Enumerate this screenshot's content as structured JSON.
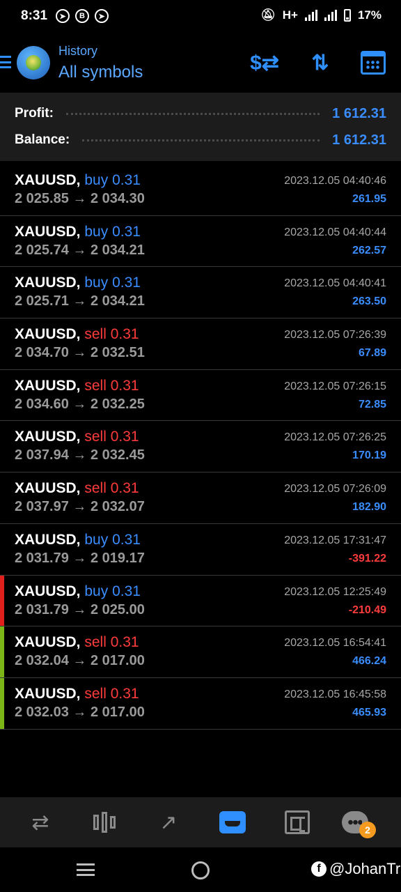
{
  "status_bar": {
    "time": "8:31",
    "network": "H+",
    "battery": "17%",
    "icons": [
      "telegram-icon",
      "b-icon",
      "telegram-icon",
      "mute-icon",
      "signal-icon",
      "signal-icon",
      "battery-icon"
    ]
  },
  "header": {
    "subtitle": "History",
    "title": "All symbols",
    "actions": [
      "dollar-swap-icon",
      "sort-icon",
      "calendar-icon"
    ]
  },
  "summary": {
    "profit_label": "Profit:",
    "profit_value": "1 612.31",
    "balance_label": "Balance:",
    "balance_value": "1 612.31"
  },
  "deals": [
    {
      "symbol": "XAUUSD,",
      "side": "buy",
      "volume": "0.31",
      "open": "2 025.85",
      "close": "2 034.30",
      "time": "2023.12.05 04:40:46",
      "profit": "261.95",
      "accent": ""
    },
    {
      "symbol": "XAUUSD,",
      "side": "buy",
      "volume": "0.31",
      "open": "2 025.74",
      "close": "2 034.21",
      "time": "2023.12.05 04:40:44",
      "profit": "262.57",
      "accent": ""
    },
    {
      "symbol": "XAUUSD,",
      "side": "buy",
      "volume": "0.31",
      "open": "2 025.71",
      "close": "2 034.21",
      "time": "2023.12.05 04:40:41",
      "profit": "263.50",
      "accent": ""
    },
    {
      "symbol": "XAUUSD,",
      "side": "sell",
      "volume": "0.31",
      "open": "2 034.70",
      "close": "2 032.51",
      "time": "2023.12.05 07:26:39",
      "profit": "67.89",
      "accent": ""
    },
    {
      "symbol": "XAUUSD,",
      "side": "sell",
      "volume": "0.31",
      "open": "2 034.60",
      "close": "2 032.25",
      "time": "2023.12.05 07:26:15",
      "profit": "72.85",
      "accent": ""
    },
    {
      "symbol": "XAUUSD,",
      "side": "sell",
      "volume": "0.31",
      "open": "2 037.94",
      "close": "2 032.45",
      "time": "2023.12.05 07:26:25",
      "profit": "170.19",
      "accent": ""
    },
    {
      "symbol": "XAUUSD,",
      "side": "sell",
      "volume": "0.31",
      "open": "2 037.97",
      "close": "2 032.07",
      "time": "2023.12.05 07:26:09",
      "profit": "182.90",
      "accent": ""
    },
    {
      "symbol": "XAUUSD,",
      "side": "buy",
      "volume": "0.31",
      "open": "2 031.79",
      "close": "2 019.17",
      "time": "2023.12.05 17:31:47",
      "profit": "-391.22",
      "accent": ""
    },
    {
      "symbol": "XAUUSD,",
      "side": "buy",
      "volume": "0.31",
      "open": "2 031.79",
      "close": "2 025.00",
      "time": "2023.12.05 12:25:49",
      "profit": "-210.49",
      "accent": "#e0201c"
    },
    {
      "symbol": "XAUUSD,",
      "side": "sell",
      "volume": "0.31",
      "open": "2 032.04",
      "close": "2 017.00",
      "time": "2023.12.05 16:54:41",
      "profit": "466.24",
      "accent": "#7cb518"
    },
    {
      "symbol": "XAUUSD,",
      "side": "sell",
      "volume": "0.31",
      "open": "2 032.03",
      "close": "2 017.00",
      "time": "2023.12.05 16:45:58",
      "profit": "465.93",
      "accent": "#7cb518"
    }
  ],
  "arrow": "→",
  "bottom_nav": {
    "items": [
      "quotes-icon",
      "chart-icon",
      "trade-icon",
      "history-icon",
      "news-icon",
      "chat-icon"
    ],
    "active": "history-icon",
    "chat_badge": "2"
  },
  "watermark": "@JohanTr",
  "colors": {
    "accent_blue": "#3a8dff",
    "sell_red": "#ff3b3b",
    "background": "#000000",
    "panel": "#1c1c1c"
  }
}
